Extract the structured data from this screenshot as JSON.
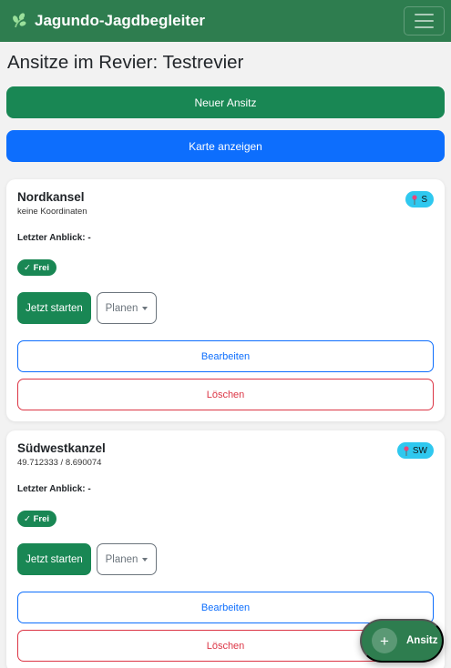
{
  "navbar": {
    "brand": "Jagundo-Jagdbegleiter",
    "brand_icon": "leaf-icon",
    "menu_icon": "hamburger-icon"
  },
  "page": {
    "title": "Ansitze im Revier: Testrevier"
  },
  "actions": {
    "new_label": "Neuer Ansitz",
    "map_label": "Karte anzeigen"
  },
  "colors": {
    "brand_green": "#2e7d4f",
    "success": "#198754",
    "primary": "#0d6efd",
    "danger": "#dc3545",
    "info": "#2fc8ef"
  },
  "stands": [
    {
      "name": "Nordkansel",
      "coords": "keine Koordinaten",
      "direction": "S",
      "last_seen": "Letzter Anblick: -",
      "status": "✓ Frei",
      "start_label": "Jetzt starten",
      "plan_label": "Planen",
      "edit_label": "Bearbeiten",
      "delete_label": "Löschen"
    },
    {
      "name": "Südwestkanzel",
      "coords": "49.712333 / 8.690074",
      "direction": "SW",
      "last_seen": "Letzter Anblick: -",
      "status": "✓ Frei",
      "start_label": "Jetzt starten",
      "plan_label": "Planen",
      "edit_label": "Bearbeiten",
      "delete_label": "Löschen"
    }
  ],
  "fab": {
    "icon": "+",
    "label": "Ansitz"
  }
}
